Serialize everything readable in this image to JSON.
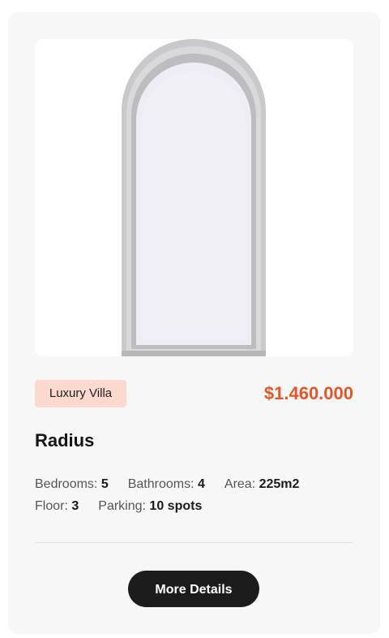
{
  "listing": {
    "tag": "Luxury Villa",
    "price": "$1.460.000",
    "title": "Radius",
    "specs": [
      {
        "label": "Bedrooms:",
        "value": "5"
      },
      {
        "label": "Bathrooms:",
        "value": "4"
      },
      {
        "label": "Area:",
        "value": "225m2"
      },
      {
        "label": "Floor:",
        "value": "3"
      },
      {
        "label": "Parking:",
        "value": "10 spots"
      }
    ],
    "button_label": "More Details"
  },
  "colors": {
    "card_bg": "#f8f7f7",
    "tag_bg": "#fbd9cf",
    "price": "#e2562a",
    "button_bg": "#1c1c1c"
  }
}
